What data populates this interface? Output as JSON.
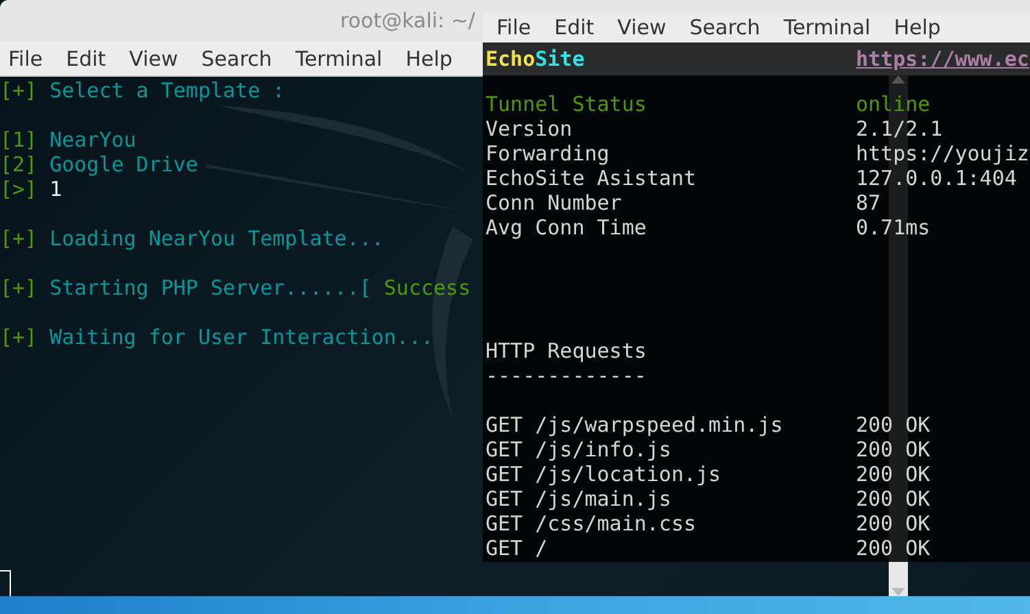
{
  "back_window": {
    "title": "root@kali: ~/",
    "menu": [
      "File",
      "Edit",
      "View",
      "Search",
      "Terminal",
      "Help"
    ],
    "blocks": [
      [
        {
          "marker": "[+]",
          "text": "Select a Template :",
          "kind": "info"
        }
      ],
      [
        {
          "marker": "[1]",
          "text": "NearYou",
          "kind": "info"
        },
        {
          "marker": "[2]",
          "text": "Google Drive",
          "kind": "info"
        },
        {
          "marker": "[>]",
          "text": "1",
          "kind": "input"
        }
      ],
      [
        {
          "marker": "[+]",
          "text": "Loading NearYou Template...",
          "kind": "info"
        }
      ],
      [
        {
          "marker": "[+]",
          "text": "Starting PHP Server......[",
          "kind": "info",
          "status": "Success"
        }
      ],
      [
        {
          "marker": "[+]",
          "text": "Waiting for User Interaction...",
          "kind": "info"
        }
      ]
    ]
  },
  "front_window": {
    "menu": [
      "File",
      "Edit",
      "View",
      "Search",
      "Terminal",
      "Help"
    ],
    "brand": [
      {
        "text": "Echo",
        "color": "#f5e14a"
      },
      {
        "text": "Site",
        "color": "#34e2e2"
      }
    ],
    "link": "https://www.ec",
    "stats": [
      {
        "label": "Tunnel Status",
        "value": "online",
        "kind": "good"
      },
      {
        "label": "Version",
        "value": "2.1/2.1",
        "kind": "plain"
      },
      {
        "label": "Forwarding",
        "value": "https://youjiz",
        "kind": "plain"
      },
      {
        "label": "EchoSite Asistant",
        "value": "127.0.0.1:404",
        "kind": "plain"
      },
      {
        "label": "Conn Number",
        "value": "87",
        "kind": "plain"
      },
      {
        "label": "Avg Conn Time",
        "value": "0.71ms",
        "kind": "plain"
      }
    ],
    "requests_heading": "HTTP Requests",
    "requests_rule": "-------------",
    "requests": [
      {
        "path": "GET /js/warpspeed.min.js",
        "status": "200 OK"
      },
      {
        "path": "GET /js/info.js",
        "status": "200 OK"
      },
      {
        "path": "GET /js/location.js",
        "status": "200 OK"
      },
      {
        "path": "GET /js/main.js",
        "status": "200 OK"
      },
      {
        "path": "GET /css/main.css",
        "status": "200 OK"
      },
      {
        "path": "GET /",
        "status": "200 OK"
      }
    ]
  }
}
